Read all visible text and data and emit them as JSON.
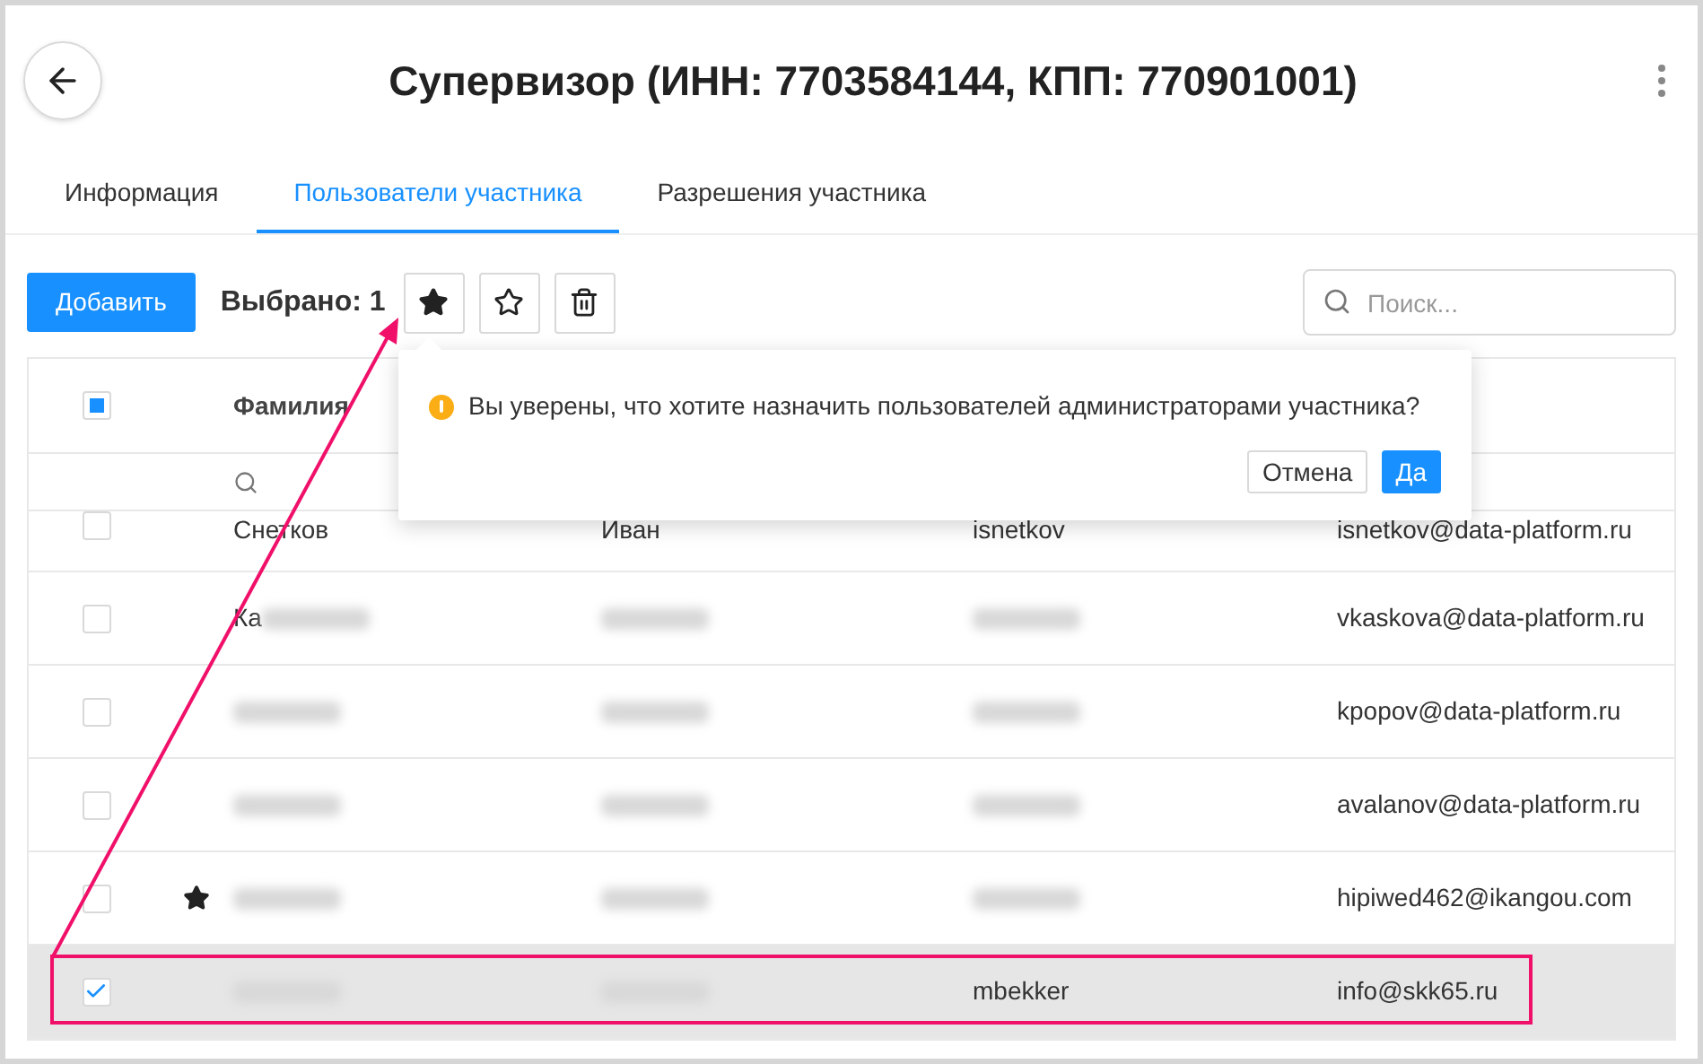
{
  "title": "Супервизор (ИНН: 7703584144, КПП: 770901001)",
  "tabs": [
    {
      "label": "Информация",
      "selected": false
    },
    {
      "label": "Пользователи участника",
      "selected": true
    },
    {
      "label": "Разрешения участника",
      "selected": false
    }
  ],
  "toolbar": {
    "add_button": "Добавить",
    "selected_count": "Выбрано: 1",
    "search_placeholder": "Поиск..."
  },
  "table": {
    "select_all_partial": true,
    "columns": [
      "Фамилия"
    ],
    "rows": [
      {
        "checked": false,
        "starred": false,
        "cells": [
          {
            "text": "Снетков"
          },
          {
            "text": "Иван"
          },
          {
            "text": "isnetkov"
          },
          {
            "text": "isnetkov@data-platform.ru"
          }
        ]
      },
      {
        "checked": false,
        "starred": false,
        "cells": [
          {
            "text": "Ка",
            "blurred": true
          },
          {
            "blurred": true
          },
          {
            "blurred": true
          },
          {
            "text": "vkaskova@data-platform.ru"
          }
        ]
      },
      {
        "checked": false,
        "starred": false,
        "cells": [
          {
            "blurred": true
          },
          {
            "blurred": true
          },
          {
            "blurred": true
          },
          {
            "text": "kpopov@data-platform.ru"
          }
        ]
      },
      {
        "checked": false,
        "starred": false,
        "cells": [
          {
            "blurred": true
          },
          {
            "blurred": true
          },
          {
            "blurred": true
          },
          {
            "text": "avalanov@data-platform.ru"
          }
        ]
      },
      {
        "checked": false,
        "starred": true,
        "cells": [
          {
            "blurred": true
          },
          {
            "blurred": true
          },
          {
            "blurred": true
          },
          {
            "text": "hipiwed462@ikangou.com"
          }
        ]
      },
      {
        "checked": true,
        "starred": false,
        "cells": [
          {
            "blurred": true
          },
          {
            "blurred": true
          },
          {
            "text": "mbekker"
          },
          {
            "text": "info@skk65.ru"
          }
        ]
      }
    ]
  },
  "popover": {
    "message": "Вы уверены, что хотите назначить пользователей администраторами участника?",
    "cancel": "Отмена",
    "confirm": "Да"
  }
}
